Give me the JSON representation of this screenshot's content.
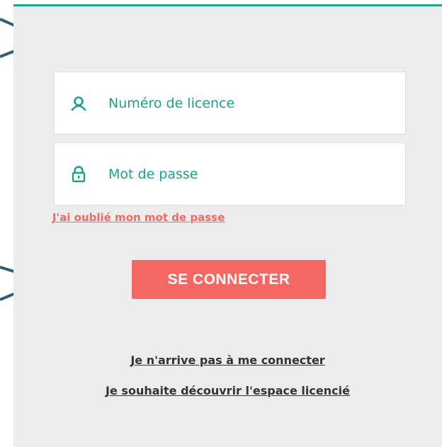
{
  "login_form": {
    "licence_field": {
      "icon": "user-icon",
      "placeholder": "Numéro de licence"
    },
    "password_field": {
      "icon": "lock-icon",
      "placeholder": "Mot de passe"
    },
    "forgot_password_link": "J'ai oublié mon mot de passe",
    "submit_label": "SE CONNECTER",
    "help_links": [
      "Je n'arrive pas à me connecter",
      "Je souhaite découvrir l'espace licencié"
    ]
  },
  "colors": {
    "accent_teal": "#1aa98b",
    "button_coral": "#f76762",
    "link_coral": "#f06a63",
    "panel_background": "#ececec",
    "pointer_lines": "#2b5d76"
  }
}
